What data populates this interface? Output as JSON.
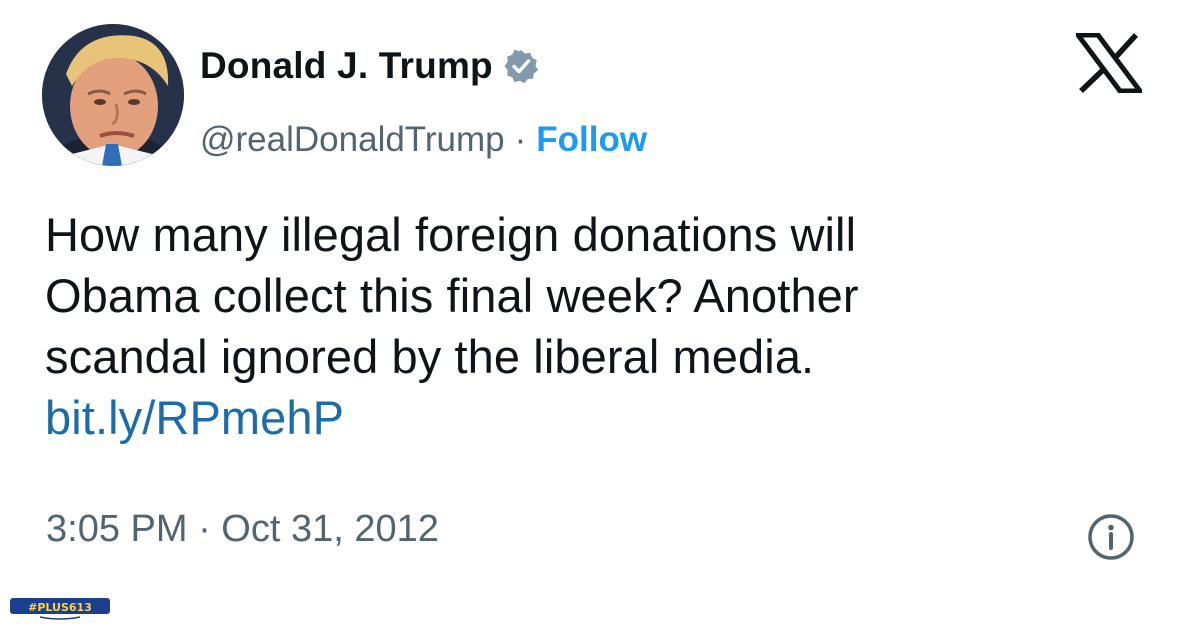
{
  "author": {
    "display_name": "Donald J. Trump",
    "handle": "@realDonaldTrump",
    "separator": "·",
    "follow_label": "Follow",
    "verified": true,
    "avatar_icon": "profile-photo"
  },
  "header": {
    "logo_icon": "x-logo-icon"
  },
  "tweet": {
    "lines": [
      "How many illegal foreign donations will",
      "Obama collect this final week? Another",
      "scandal ignored by the liberal media."
    ],
    "link": "bit.ly/RPmehP"
  },
  "footer": {
    "timestamp": "3:05 PM · Oct 31, 2012",
    "info_icon": "info-icon"
  },
  "watermark": {
    "text": "#PLUS613"
  },
  "colors": {
    "text": "#0f1419",
    "secondary": "#536471",
    "accent": "#1d9bf0",
    "link": "#1b6ca8",
    "badge": "#829aab"
  }
}
